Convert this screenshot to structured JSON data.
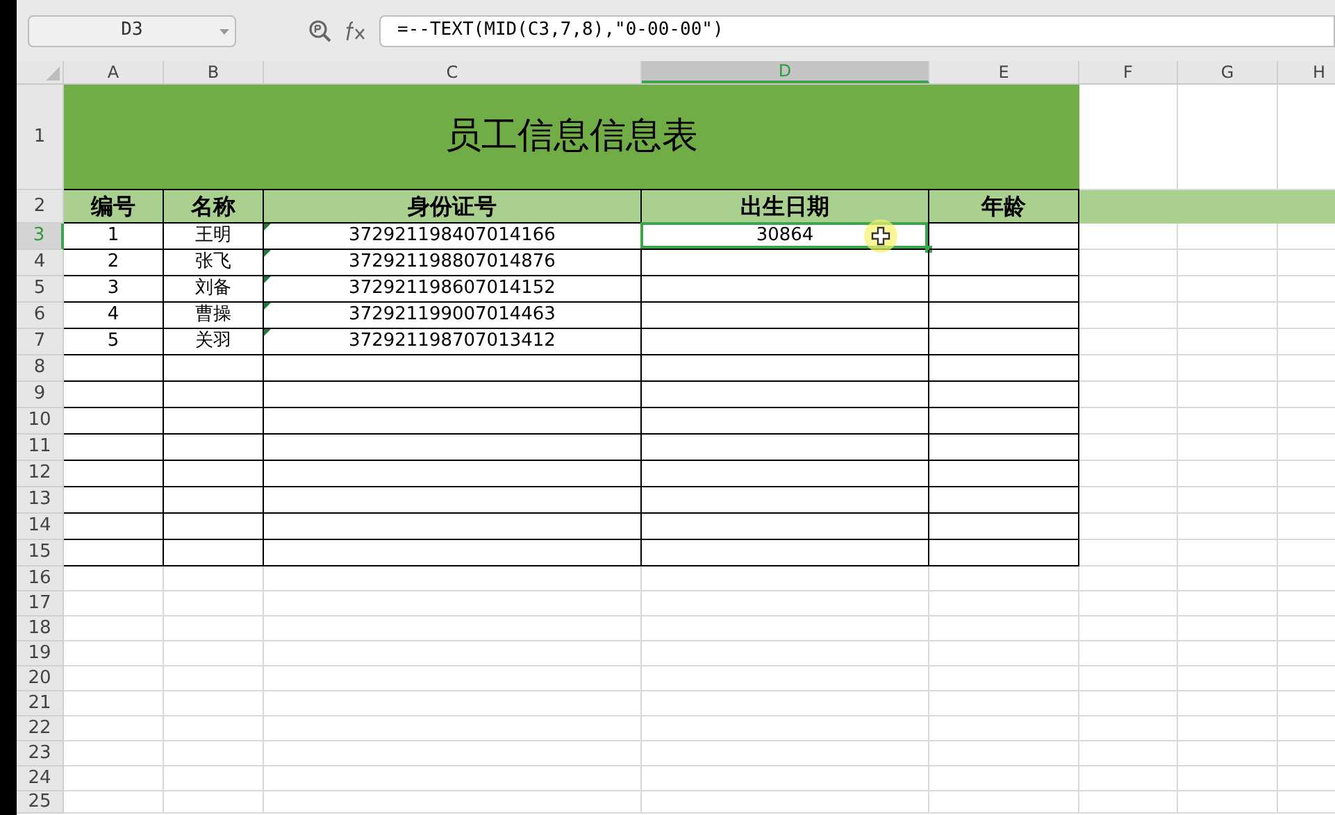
{
  "name_box": "D3",
  "formula": "=--TEXT(MID(C3,7,8),\"0-00-00\")",
  "columns": [
    {
      "label": "A",
      "selected": false
    },
    {
      "label": "B",
      "selected": false
    },
    {
      "label": "C",
      "selected": false
    },
    {
      "label": "D",
      "selected": true
    },
    {
      "label": "E",
      "selected": false
    },
    {
      "label": "F",
      "selected": false
    },
    {
      "label": "G",
      "selected": false
    },
    {
      "label": "H",
      "selected": false
    }
  ],
  "title_row": {
    "label": "1",
    "text": "员工信息信息表"
  },
  "header_row": {
    "label": "2",
    "cells": [
      "编号",
      "名称",
      "身份证号",
      "出生日期",
      "年龄"
    ]
  },
  "rows": [
    {
      "label": "3",
      "selected": true,
      "number": "1",
      "name": "王明",
      "id": "372921198407014166",
      "birth_date": "30864",
      "text_number_flag": true
    },
    {
      "label": "4",
      "selected": false,
      "number": "2",
      "name": "张飞",
      "id": "372921198807014876",
      "text_number_flag": true
    },
    {
      "label": "5",
      "selected": false,
      "number": "3",
      "name": "刘备",
      "id": "372921198607014152",
      "text_number_flag": true
    },
    {
      "label": "6",
      "selected": false,
      "number": "4",
      "name": "曹操",
      "id": "372921199007014463",
      "text_number_flag": true
    },
    {
      "label": "7",
      "selected": false,
      "number": "5",
      "name": "关羽",
      "id": "372921198707013412",
      "text_number_flag": true
    }
  ],
  "empty_table_rows": [
    "8",
    "9",
    "10",
    "11",
    "12",
    "13",
    "14",
    "15"
  ],
  "blank_rows": [
    "16",
    "17",
    "18",
    "19",
    "20",
    "21",
    "22",
    "23",
    "24",
    "25"
  ]
}
